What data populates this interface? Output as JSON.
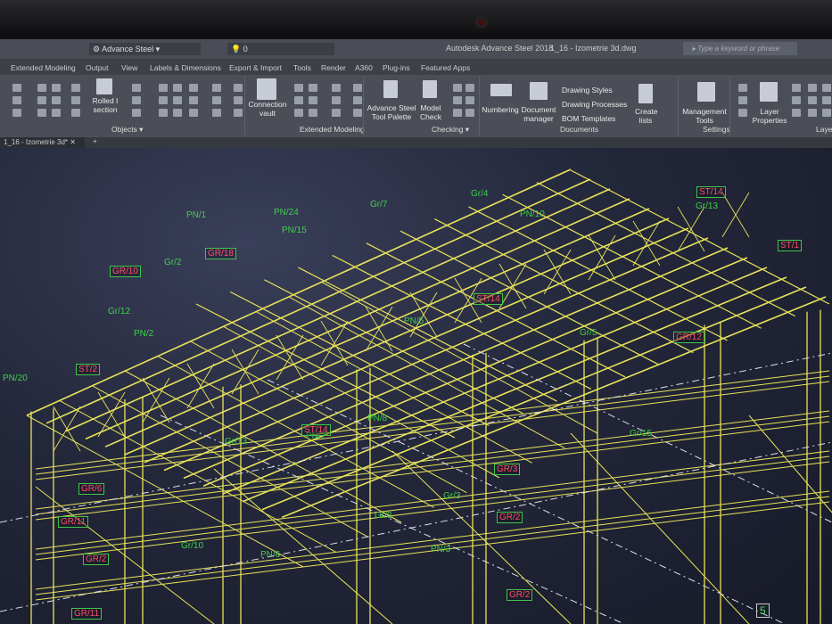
{
  "quick_access": {
    "workspace": "Advance Steel",
    "layer": "0"
  },
  "title_bar": {
    "app": "Autodesk Advance Steel 2018",
    "file": "1_16 - Izometrie 3d.dwg",
    "search_placeholder": "Type a keyword or phrase"
  },
  "ribbon_tabs": [
    "Extended Modeling",
    "Output",
    "View",
    "Labels & Dimensions",
    "Export & Import",
    "Tools",
    "Render",
    "A360",
    "Plug-ins",
    "Featured Apps"
  ],
  "ribbon": {
    "buttons": {
      "rolled_section": "Rolled I section",
      "connection_vault": "Connection vault",
      "tool_palette": "Advance Steel Tool Palette",
      "model_check": "Model Check",
      "numbering": "Numbering",
      "document_manager": "Document manager",
      "drawing_styles": "Drawing Styles",
      "drawing_processes": "Drawing Processes",
      "bom_templates": "BOM Templates",
      "create_lists": "Create lists",
      "management_tools": "Management Tools",
      "layer_properties": "Layer Properties"
    },
    "groups": {
      "objects": "Objects ▾",
      "extended_modeling": "Extended Modeling",
      "checking": "Checking ▾",
      "documents": "Documents",
      "settings": "Settings",
      "layers": "Layer"
    }
  },
  "document_tab": "1_16 - Izometrie 3d*",
  "labels": {
    "green": [
      "PN/1",
      "PN/24",
      "PN/15",
      "Gr/7",
      "Gr/4",
      "PN/10",
      "Gr/13",
      "Gr/2",
      "Gr/12",
      "PN/2",
      "PN/20",
      "PN/5",
      "Gr/5",
      "PN/8",
      "PN/7",
      "Gr/13",
      "Gr/15",
      "Gr/3",
      "Gr/8",
      "Gr/10",
      "PN/6",
      "PN/3"
    ],
    "red": [
      "GR/18",
      "GR/10",
      "ST/2",
      "ST/14",
      "ST/1",
      "ST/14",
      "GR/12",
      "ST/14",
      "GR/6",
      "GR/11",
      "GR/2",
      "GR/11",
      "GR/3",
      "GR/2",
      "GR/2"
    ],
    "view_number": "5"
  },
  "colors": {
    "structure": "#e8e35a",
    "label_green": "#3fd04a",
    "label_red": "#ff4d6a",
    "background": "#1e2233"
  }
}
